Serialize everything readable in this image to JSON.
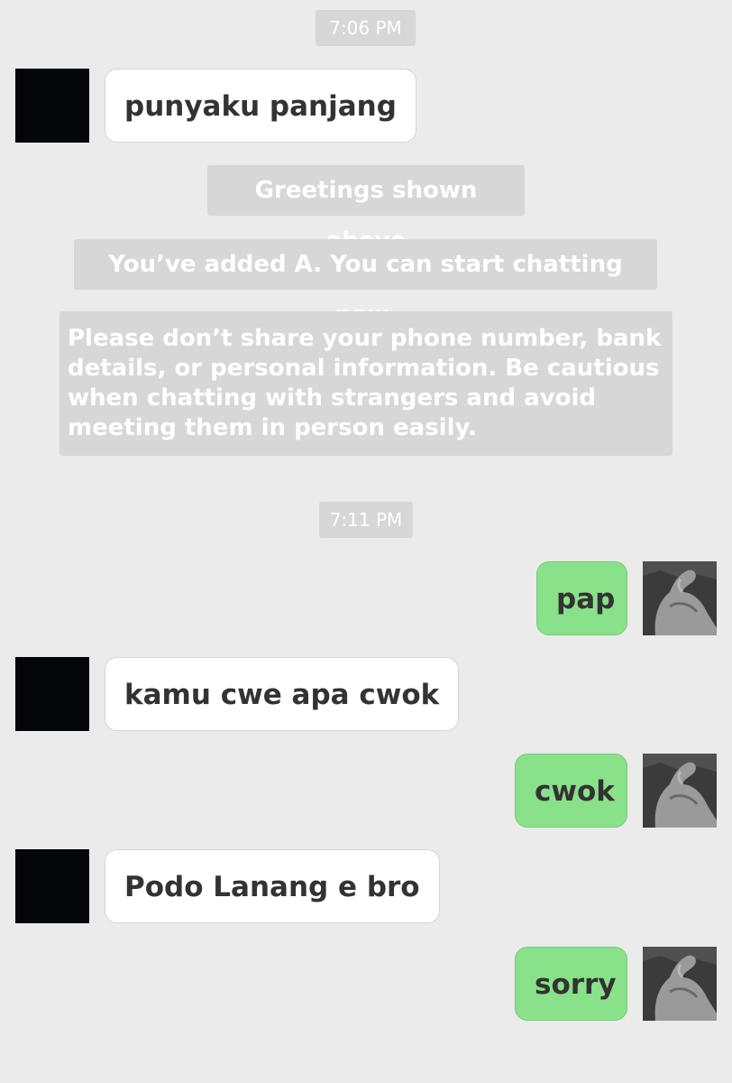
{
  "timestamps": [
    "7:06 PM",
    "7:11 PM"
  ],
  "system_notices": {
    "greetings": "Greetings shown above",
    "added": "You’ve added A. You can start chatting now.",
    "safety_lines": [
      "Please don’t share your phone number, bank",
      "details, or personal information. Be cautious",
      "when chatting with strangers and avoid",
      "meeting them in person easily."
    ]
  },
  "messages": [
    {
      "from": "contact",
      "text": "punyaku panjang"
    },
    {
      "from": "me",
      "text": "pap"
    },
    {
      "from": "contact",
      "text": "kamu cwe apa cwok"
    },
    {
      "from": "me",
      "text": "cwok"
    },
    {
      "from": "contact",
      "text": "Podo Lanang e bro"
    },
    {
      "from": "me",
      "text": "sorry"
    }
  ],
  "avatars": {
    "contact": "black-square-avatar",
    "me": "flexed-arm-photo-avatar"
  },
  "colors": {
    "background": "#ebebeb",
    "notice_pill": "#d7d7d7",
    "incoming_bubble": "#ffffff",
    "outgoing_bubble": "#89e189",
    "text": "#333333"
  }
}
